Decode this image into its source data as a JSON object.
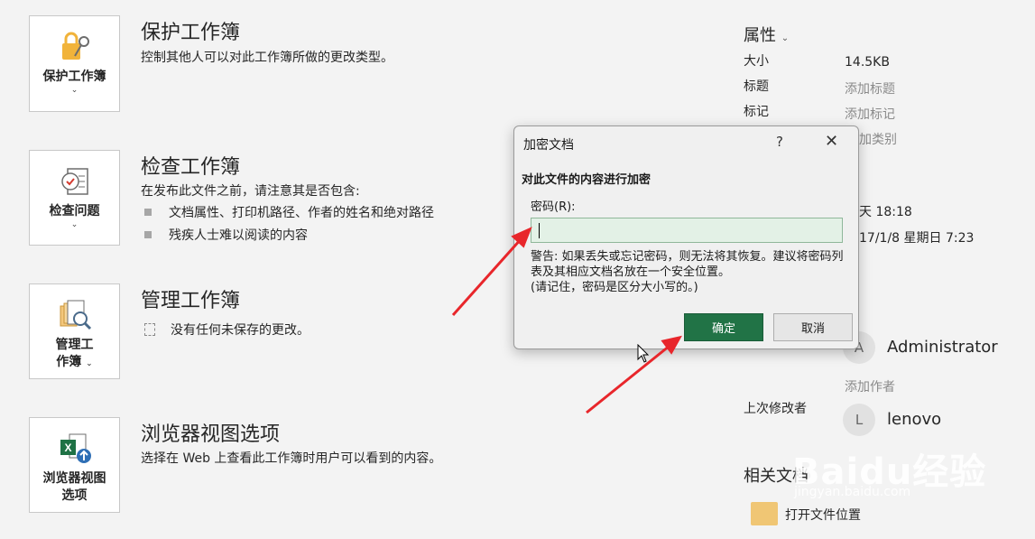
{
  "sections": [
    {
      "tile_label": "保护工作簿",
      "title": "保护工作簿",
      "desc": "控制其他人可以对此工作簿所做的更改类型。",
      "icon": "lock-key-icon"
    },
    {
      "tile_label": "检查问题",
      "title": "检查工作簿",
      "desc": "在发布此文件之前，请注意其是否包含:",
      "bullets": [
        "文档属性、打印机路径、作者的姓名和绝对路径",
        "残疾人士难以阅读的内容"
      ],
      "icon": "inspect-checklist-icon"
    },
    {
      "tile_label_1": "管理工",
      "tile_label_2": "作簿",
      "title": "管理工作簿",
      "note": "没有任何未保存的更改。",
      "icon": "manage-workbook-icon"
    },
    {
      "tile_label_1": "浏览器视图",
      "tile_label_2": "选项",
      "title": "浏览器视图选项",
      "desc": "选择在 Web 上查看此工作簿时用户可以看到的内容。",
      "icon": "excel-upload-icon"
    }
  ],
  "properties": {
    "header": "属性",
    "size_label": "大小",
    "size_value": "14.5KB",
    "title_label": "标题",
    "title_value": "添加标题",
    "tag_label": "标记",
    "tag_value": "添加标记",
    "category_value": "加类别",
    "modified_value": "天 18:18",
    "created_value": "17/1/8 星期日 7:23",
    "author_avatar": "A",
    "author_name": "Administrator",
    "add_author": "添加作者",
    "last_modified_label": "上次修改者",
    "modifier_avatar": "L",
    "modifier_name": "lenovo",
    "related_docs": "相关文档",
    "open_location": "打开文件位置"
  },
  "dialog": {
    "title": "加密文档",
    "help": "?",
    "close": "✕",
    "heading": "对此文件的内容进行加密",
    "password_label": "密码(R):",
    "warning": "警告: 如果丢失或忘记密码，则无法将其恢复。建议将密码列表及其相应文档名放在一个安全位置。",
    "warning_note": "(请记住，密码是区分大小写的。)",
    "ok": "确定",
    "cancel": "取消"
  },
  "watermark": {
    "text": "Baidu经验",
    "sub": "jingyan.baidu.com"
  },
  "colors": {
    "accent": "#217346",
    "arrow": "#e8262b",
    "input_bg": "#e3f1e6"
  }
}
